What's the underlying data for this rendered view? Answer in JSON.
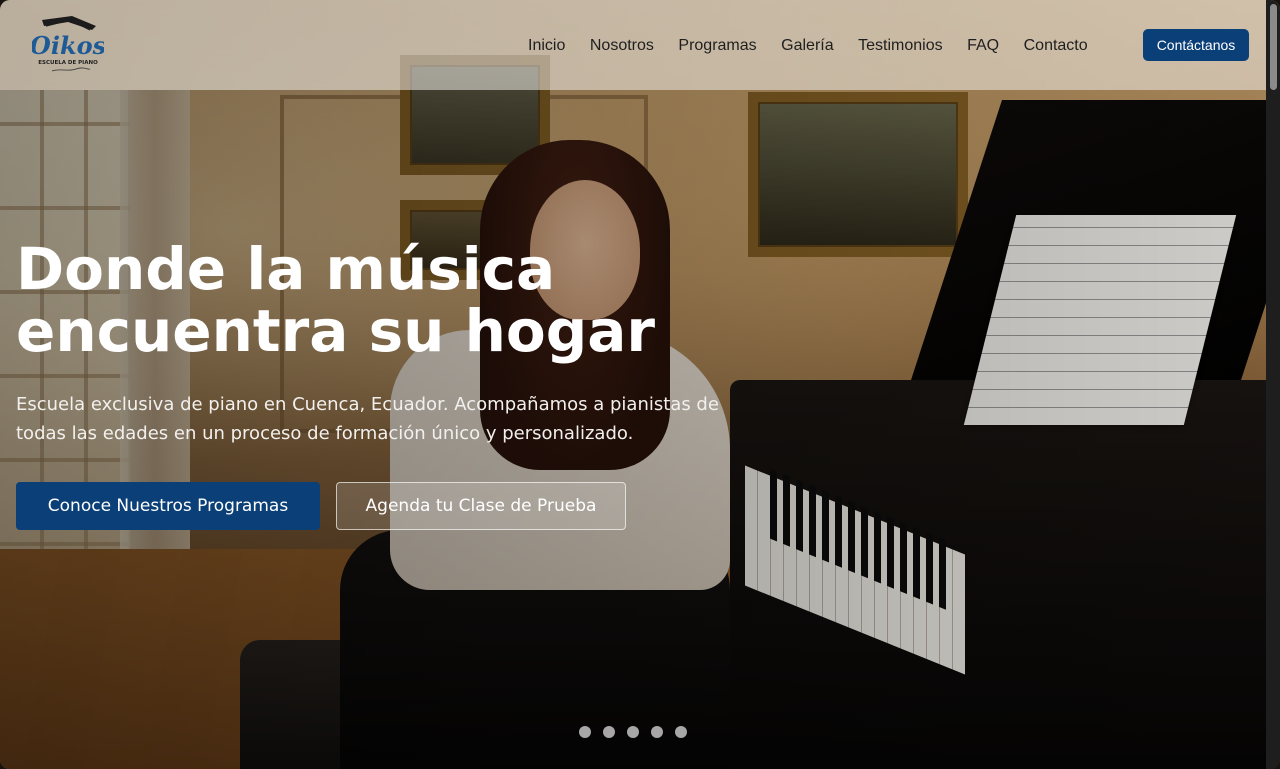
{
  "brand": {
    "logo_text": "Oikos",
    "logo_subtitle": "ESCUELA DE PIANO",
    "colors": {
      "primary": "#0b3f78",
      "header_bg": "#f0ece8"
    }
  },
  "nav": {
    "items": [
      {
        "label": "Inicio"
      },
      {
        "label": "Nosotros"
      },
      {
        "label": "Programas"
      },
      {
        "label": "Galería"
      },
      {
        "label": "Testimonios"
      },
      {
        "label": "FAQ"
      },
      {
        "label": "Contacto"
      }
    ],
    "cta_label": "Contáctanos"
  },
  "hero": {
    "title_line1": "Donde la música",
    "title_line2": "encuentra su hogar",
    "subtitle": "Escuela exclusiva de piano en Cuenca, Ecuador. Acompañamos a pianistas de todas las edades en un proceso de formación único y personalizado.",
    "primary_button": "Conoce Nuestros Programas",
    "secondary_button": "Agenda tu Clase de Prueba",
    "carousel": {
      "slide_count": 5,
      "active_index": 0
    }
  }
}
